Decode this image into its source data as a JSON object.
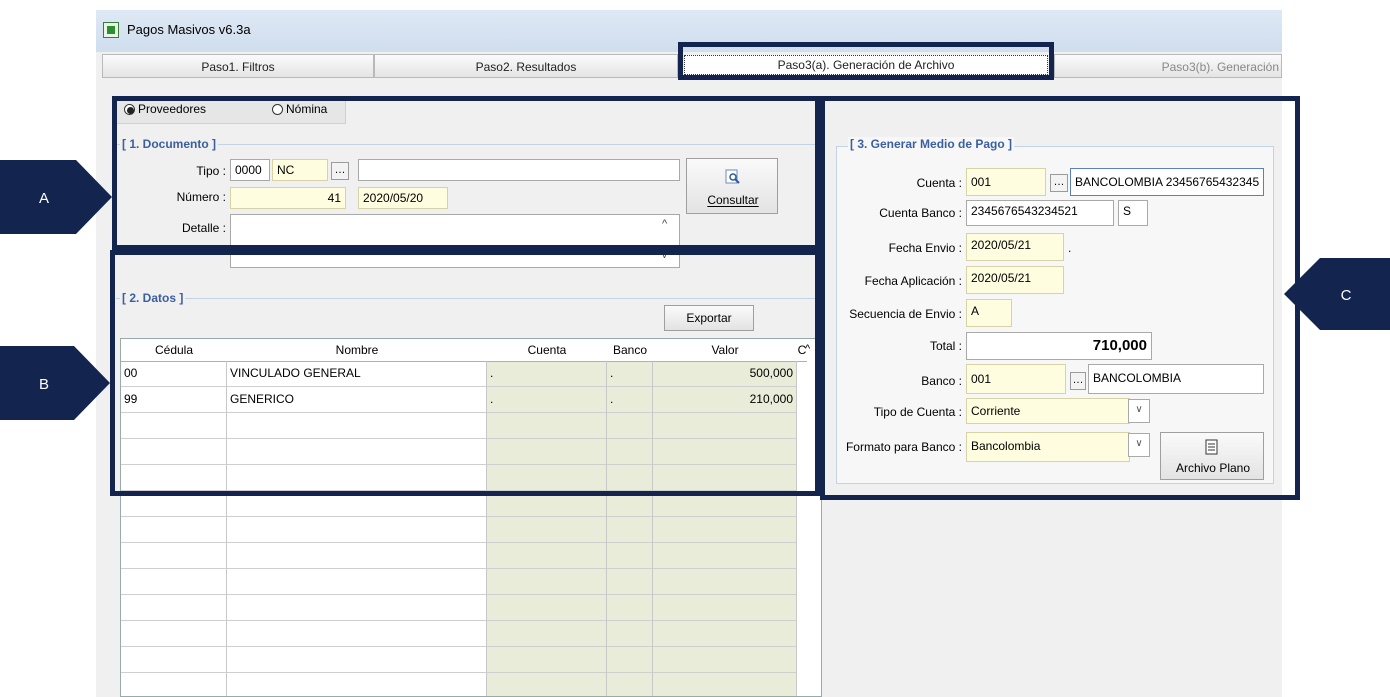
{
  "window": {
    "title": "Pagos Masivos v6.3a"
  },
  "tabs": [
    {
      "label": "Paso1. Filtros"
    },
    {
      "label": "Paso2. Resultados"
    },
    {
      "label": "Paso3(a). Generación de Archivo"
    },
    {
      "label": "Paso3(b). Generación"
    }
  ],
  "mode": {
    "option1": "Proveedores",
    "option2": "Nómina",
    "selected": "Proveedores"
  },
  "documento": {
    "legend": "[ 1. Documento ]",
    "tipo_label": "Tipo :",
    "tipo_code": "0000",
    "tipo_abbr": "NC",
    "tipo_desc": "",
    "numero_label": "Número :",
    "numero": "41",
    "fecha": "2020/05/20",
    "detalle_label": "Detalle :",
    "detalle": "",
    "consultar_label": "Consultar"
  },
  "datos": {
    "legend": "[ 2. Datos ]",
    "exportar_label": "Exportar",
    "columns": [
      "Cédula",
      "Nombre",
      "Cuenta",
      "Banco",
      "Valor",
      "C"
    ],
    "rows": [
      {
        "cedula": "00",
        "nombre": "VINCULADO GENERAL",
        "cuenta": ".",
        "banco": ".",
        "valor": "500,000"
      },
      {
        "cedula": "99",
        "nombre": "GENERICO",
        "cuenta": ".",
        "banco": ".",
        "valor": "210,000"
      }
    ]
  },
  "medio_pago": {
    "legend": "[ 3. Generar Medio de Pago ]",
    "cuenta_label": "Cuenta :",
    "cuenta": "001",
    "cuenta_desc": "BANCOLOMBIA 23456765432345",
    "cuenta_banco_label": "Cuenta Banco :",
    "cuenta_banco": "2345676543234521",
    "cuenta_banco_tipo": "S",
    "fecha_envio_label": "Fecha Envio :",
    "fecha_envio": "2020/05/21",
    "fecha_envio_suffix": ".",
    "fecha_aplicacion_label": "Fecha Aplicación :",
    "fecha_aplicacion": "2020/05/21",
    "secuencia_label": "Secuencia de Envio :",
    "secuencia": "A",
    "total_label": "Total :",
    "total": "710,000",
    "banco_label": "Banco :",
    "banco": "001",
    "banco_desc": "BANCOLOMBIA",
    "tipo_cuenta_label": "Tipo de Cuenta :",
    "tipo_cuenta": "Corriente",
    "formato_label": "Formato para Banco :",
    "formato": "Bancolombia",
    "archivo_plano_label": "Archivo Plano"
  },
  "callouts": {
    "a": "A",
    "b": "B",
    "c": "C"
  },
  "colors": {
    "callout": "#13254f",
    "legend": "#3a5fa0",
    "highlight_field": "#fffde0"
  }
}
